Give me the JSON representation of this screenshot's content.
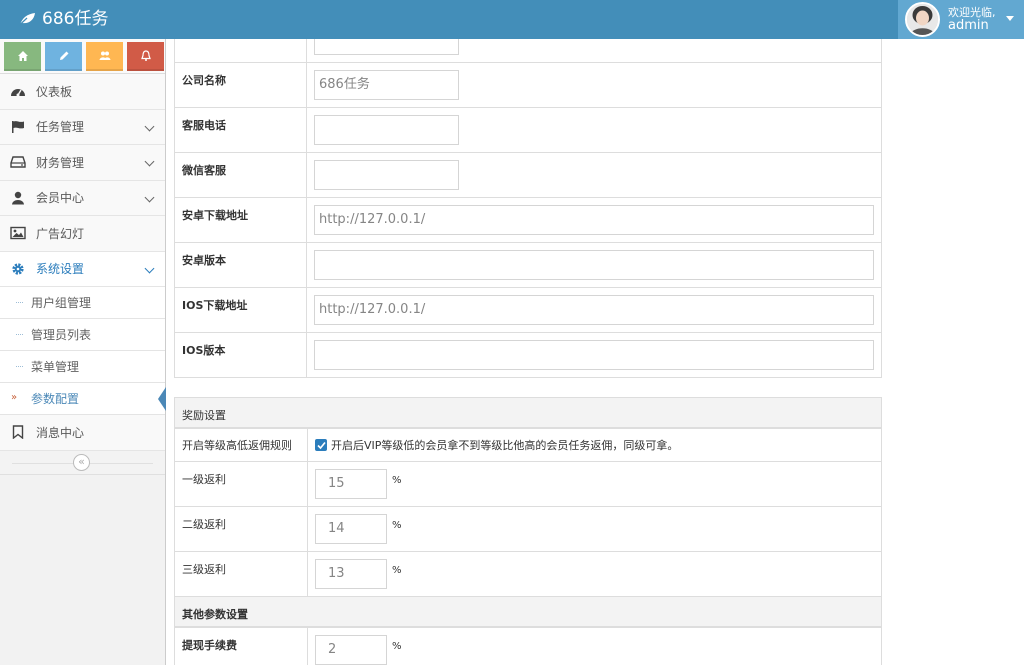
{
  "brand": {
    "name": "686任务",
    "icon": "leaf-icon"
  },
  "user": {
    "welcome": "欢迎光临,",
    "name": "admin"
  },
  "shortcuts": [
    {
      "icon": "home-icon",
      "color": "#87b87f"
    },
    {
      "icon": "pencil-icon",
      "color": "#6fb3e0"
    },
    {
      "icon": "users-icon",
      "color": "#ffb752"
    },
    {
      "icon": "bell-icon",
      "color": "#d15b47"
    }
  ],
  "sidebar": {
    "items": [
      {
        "label": "仪表板",
        "icon": "dashboard-icon"
      },
      {
        "label": "任务管理",
        "icon": "flag-icon"
      },
      {
        "label": "财务管理",
        "icon": "hdd-icon"
      },
      {
        "label": "会员中心",
        "icon": "user-icon"
      },
      {
        "label": "广告幻灯",
        "icon": "picture-icon"
      },
      {
        "label": "系统设置",
        "icon": "gear-icon"
      },
      {
        "label": "消息中心",
        "icon": "bookmark-icon"
      }
    ],
    "subitems": [
      "用户组管理",
      "管理员列表",
      "菜单管理",
      "参数配置"
    ],
    "collapse_glyph": "«"
  },
  "form": {
    "basic_rows": [
      {
        "label": "公司名称",
        "value": "686任务"
      },
      {
        "label": "客服电话",
        "value": ""
      },
      {
        "label": "微信客服",
        "value": ""
      },
      {
        "label": "安卓下载地址",
        "value": "http://127.0.0.1/"
      },
      {
        "label": "安卓版本",
        "value": ""
      },
      {
        "label": "IOS下载地址",
        "value": "http://127.0.0.1/"
      },
      {
        "label": "IOS版本",
        "value": ""
      }
    ],
    "reward_section": "奖励设置",
    "rule_label": "开启等级高低返佣规则",
    "rule_checkbox_text": "开启后VIP等级低的会员拿不到等级比他高的会员任务返佣，同级可拿。",
    "rule_checked": true,
    "reward_rows": [
      {
        "label": "一级返利",
        "value": "15",
        "unit": "%"
      },
      {
        "label": "二级返利",
        "value": "14",
        "unit": "%"
      },
      {
        "label": "三级返利",
        "value": "13",
        "unit": "%"
      }
    ],
    "other_section": "其他参数设置",
    "fee_row": {
      "label": "提现手续费",
      "value": "2",
      "unit": "%"
    }
  },
  "colors": {
    "navbar": "#438eb9",
    "user_box": "#62a8d1",
    "active": "#2b7dbc"
  }
}
